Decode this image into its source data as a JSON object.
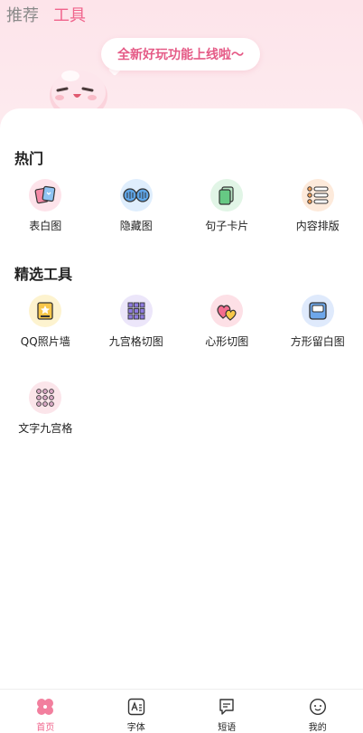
{
  "top_tabs": [
    {
      "label": "推荐",
      "active": false
    },
    {
      "label": "工具",
      "active": true
    }
  ],
  "banner": {
    "bubble_text": "全新好玩功能上线啦～"
  },
  "sections": [
    {
      "title": "热门",
      "items": [
        {
          "label": "表白图",
          "icon": "photo-cards-icon",
          "bg": "#fde3ea"
        },
        {
          "label": "隐藏图",
          "icon": "binoculars-icon",
          "bg": "#dfeefd"
        },
        {
          "label": "句子卡片",
          "icon": "card-stack-icon",
          "bg": "#e1f5e6"
        },
        {
          "label": "内容排版",
          "icon": "list-layout-icon",
          "bg": "#fdeadb"
        }
      ]
    },
    {
      "title": "精选工具",
      "items": [
        {
          "label": "QQ照片墙",
          "icon": "photo-wall-icon",
          "bg": "#fdf3cf"
        },
        {
          "label": "九宫格切图",
          "icon": "grid-nine-icon",
          "bg": "#ece6fa"
        },
        {
          "label": "心形切图",
          "icon": "hearts-icon",
          "bg": "#fde0e6"
        },
        {
          "label": "方形留白图",
          "icon": "square-frame-icon",
          "bg": "#dfeafc"
        },
        {
          "label": "文字九宫格",
          "icon": "text-grid-icon",
          "bg": "#fbe5ea"
        }
      ]
    }
  ],
  "bottom_nav": [
    {
      "label": "首页",
      "icon": "clover-icon",
      "active": true
    },
    {
      "label": "字体",
      "icon": "font-icon",
      "active": false
    },
    {
      "label": "短语",
      "icon": "phrase-icon",
      "active": false
    },
    {
      "label": "我的",
      "icon": "profile-icon",
      "active": false
    }
  ],
  "colors": {
    "accent": "#f0648c",
    "header_bg": "#fde4ea"
  }
}
